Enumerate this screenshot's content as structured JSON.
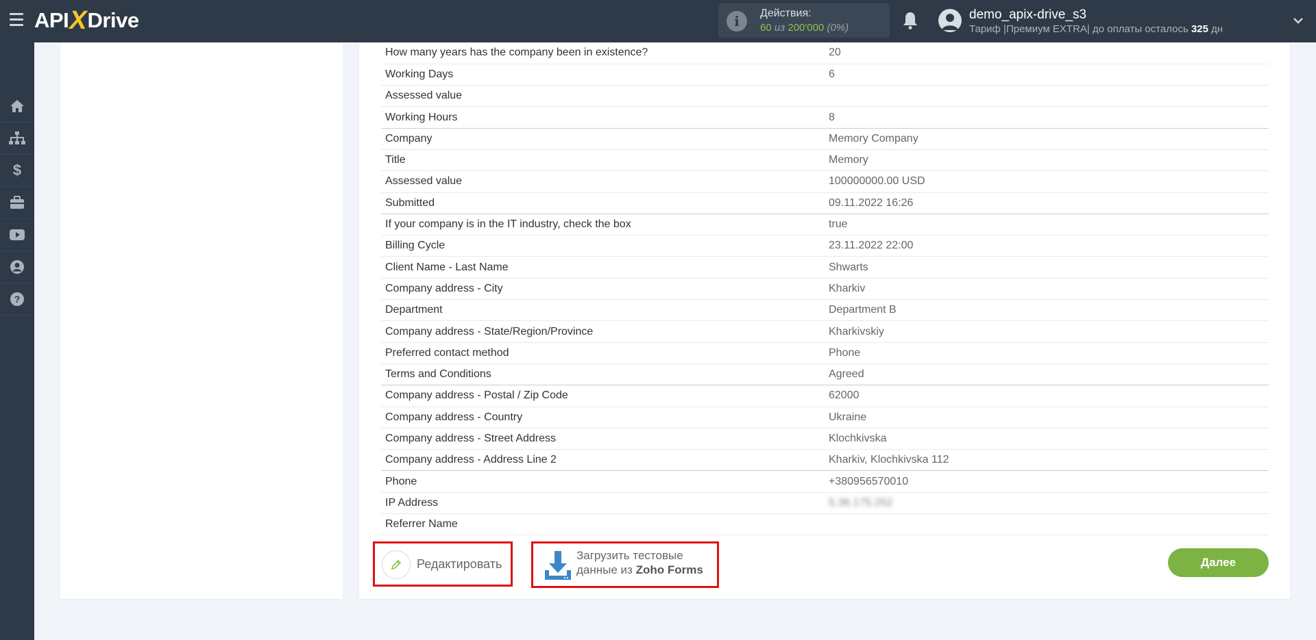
{
  "brand": {
    "left": "API",
    "x": "X",
    "right": "Drive"
  },
  "header": {
    "actions_label": "Действия:",
    "actions_used": "60",
    "actions_of": "из",
    "actions_total": "200'000",
    "actions_pct": "(0%)",
    "user_name": "demo_apix-drive_s3",
    "plan_prefix": "Тариф |Премиум EXTRA| до оплаты осталось",
    "plan_days": "325",
    "plan_suffix": "дн"
  },
  "sidebar": {
    "items": [
      "home-icon",
      "sitemap-icon",
      "dollar-icon",
      "briefcase-icon",
      "youtube-icon",
      "user-icon",
      "help-icon"
    ]
  },
  "rows": [
    {
      "key": "How many years has the company been in existence?",
      "value": "20"
    },
    {
      "key": "Working Days",
      "value": "6"
    },
    {
      "key": "Assessed value",
      "value": ""
    },
    {
      "key": "Working Hours",
      "value": "8"
    },
    {
      "key": "Company",
      "value": "Memory Company"
    },
    {
      "key": "Title",
      "value": "Memory"
    },
    {
      "key": "Assessed value",
      "value": "100000000.00 USD"
    },
    {
      "key": "Submitted",
      "value": "09.11.2022 16:26"
    },
    {
      "key": "If your company is in the IT industry, check the box",
      "value": "true"
    },
    {
      "key": "Billing Cycle",
      "value": "23.11.2022 22:00"
    },
    {
      "key": "Client Name - Last Name",
      "value": "Shwarts"
    },
    {
      "key": "Company address - City",
      "value": "Kharkiv"
    },
    {
      "key": "Department",
      "value": "Department B"
    },
    {
      "key": "Company address - State/Region/Province",
      "value": "Kharkivskiy"
    },
    {
      "key": "Preferred contact method",
      "value": "Phone"
    },
    {
      "key": "Terms and Conditions",
      "value": "Agreed"
    },
    {
      "key": "Company address - Postal / Zip Code",
      "value": "62000"
    },
    {
      "key": "Company address - Country",
      "value": "Ukraine"
    },
    {
      "key": "Company address - Street Address",
      "value": "Klochkivska"
    },
    {
      "key": "Company address - Address Line 2",
      "value": "Kharkiv, Klochkivska 112"
    },
    {
      "key": "Phone",
      "value": "+380956570010"
    },
    {
      "key": "IP Address",
      "value": "5.36.175.252"
    },
    {
      "key": "Referrer Name",
      "value": ""
    }
  ],
  "buttons": {
    "edit": "Редактировать",
    "load_line1": "Загрузить тестовые",
    "load_line2_prefix": "данные из",
    "load_line2_service": "Zoho Forms",
    "next": "Далее"
  },
  "colors": {
    "topbar": "#2e3a48",
    "accent_green": "#7cb342",
    "highlight_red": "#e11010",
    "logo_x": "#f7c52b"
  }
}
